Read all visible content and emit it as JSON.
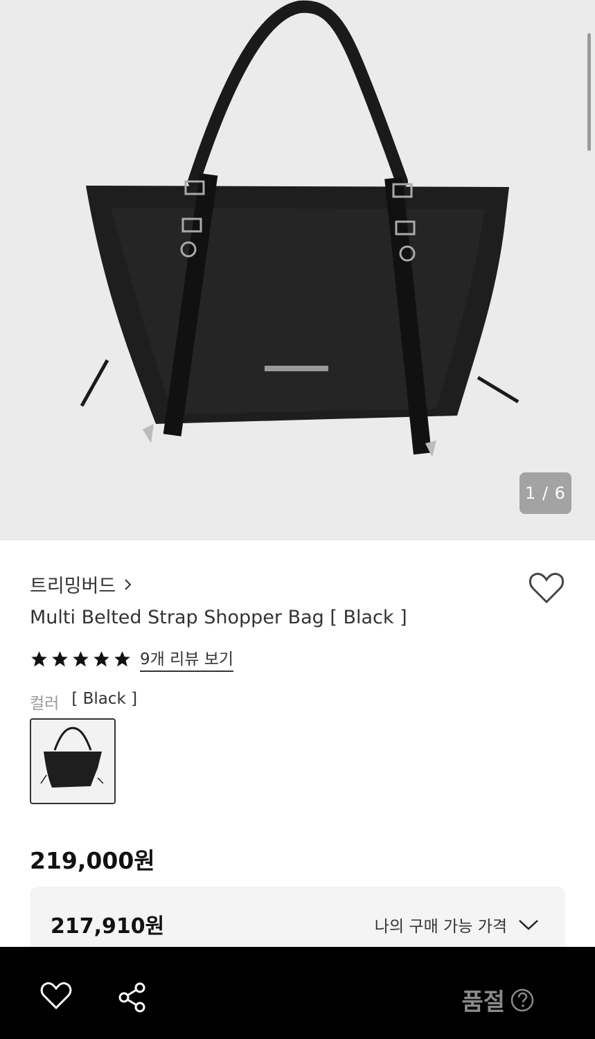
{
  "gallery": {
    "image_counter": "1 / 6",
    "product_image": "black-tote-bag"
  },
  "product": {
    "brand": "트리밍버드",
    "title": "Multi Belted Strap Shopper Bag [ Black ]",
    "rating_stars": 5,
    "review_link": "9개 리뷰 보기",
    "color_label": "컬러",
    "color_value": "[ Black ]",
    "price": "219,000원"
  },
  "my_price": {
    "price": "217,910원",
    "label": "나의 구매 가능 가격"
  },
  "bottom_bar": {
    "status": "품절",
    "icons": [
      "heart-icon",
      "share-icon",
      "help-icon"
    ]
  },
  "colors": {
    "gallery_bg": "#ebebeb",
    "bottom_bar_bg": "#000000",
    "sold_out_text": "#8a8a8a"
  }
}
